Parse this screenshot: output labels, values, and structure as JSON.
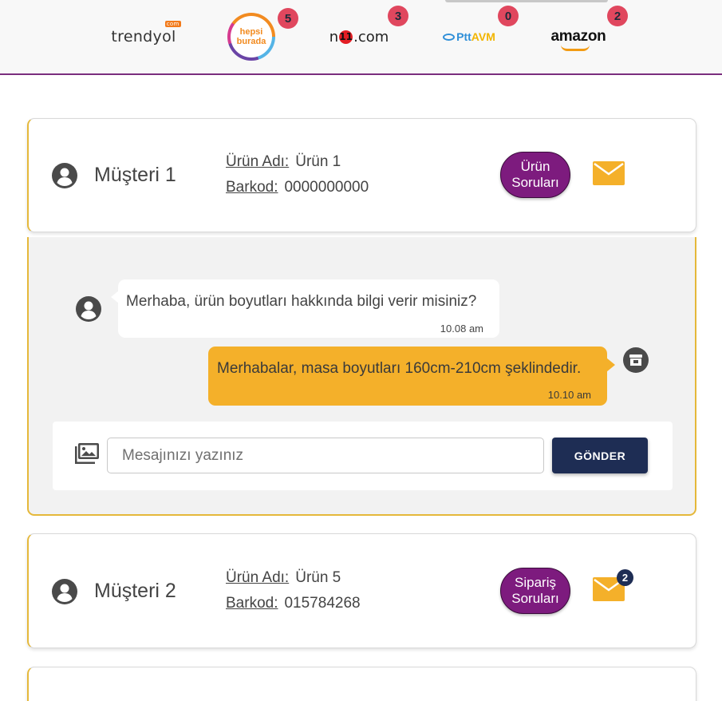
{
  "stores": [
    {
      "name": "trendyol",
      "dotcom": "com",
      "count": null
    },
    {
      "name": "hepsiburada",
      "line1": "hepsi",
      "line2": "burada",
      "count": "5"
    },
    {
      "name": "n",
      "bug": "11",
      "suffix": ".com",
      "count": "3"
    },
    {
      "name": "Ptt",
      "avm": "AVM",
      "count": "0"
    },
    {
      "name": "amazon",
      "count": "2"
    }
  ],
  "cards": [
    {
      "customer": "Müşteri 1",
      "product_label": "Ürün Adı:",
      "product": "Ürün 1",
      "barcode_label": "Barkod:",
      "barcode": "0000000000",
      "pill_line1": "Ürün",
      "pill_line2": "Soruları",
      "mail_count": null
    },
    {
      "customer": "Müşteri 2",
      "product_label": "Ürün Adı:",
      "product": "Ürün 5",
      "barcode_label": "Barkod:",
      "barcode": "015784268",
      "pill_line1": "Sipariş",
      "pill_line2": "Soruları",
      "mail_count": "2"
    }
  ],
  "chat": {
    "messages": [
      {
        "from": "customer",
        "text": "Merhaba, ürün boyutları hakkında bilgi verir misiniz?",
        "time": "10.08 am"
      },
      {
        "from": "store",
        "text": "Merhabalar, masa boyutları 160cm-210cm şeklindedir.",
        "time": "10.10 am"
      }
    ],
    "input_placeholder": "Mesajınızı yazınız",
    "send_label": "GÖNDER"
  },
  "colors": {
    "brand_purple": "#7d1b7e",
    "accent_yellow": "#f4b02a",
    "navy": "#1e2d54",
    "badge_red": "#e0475e"
  }
}
